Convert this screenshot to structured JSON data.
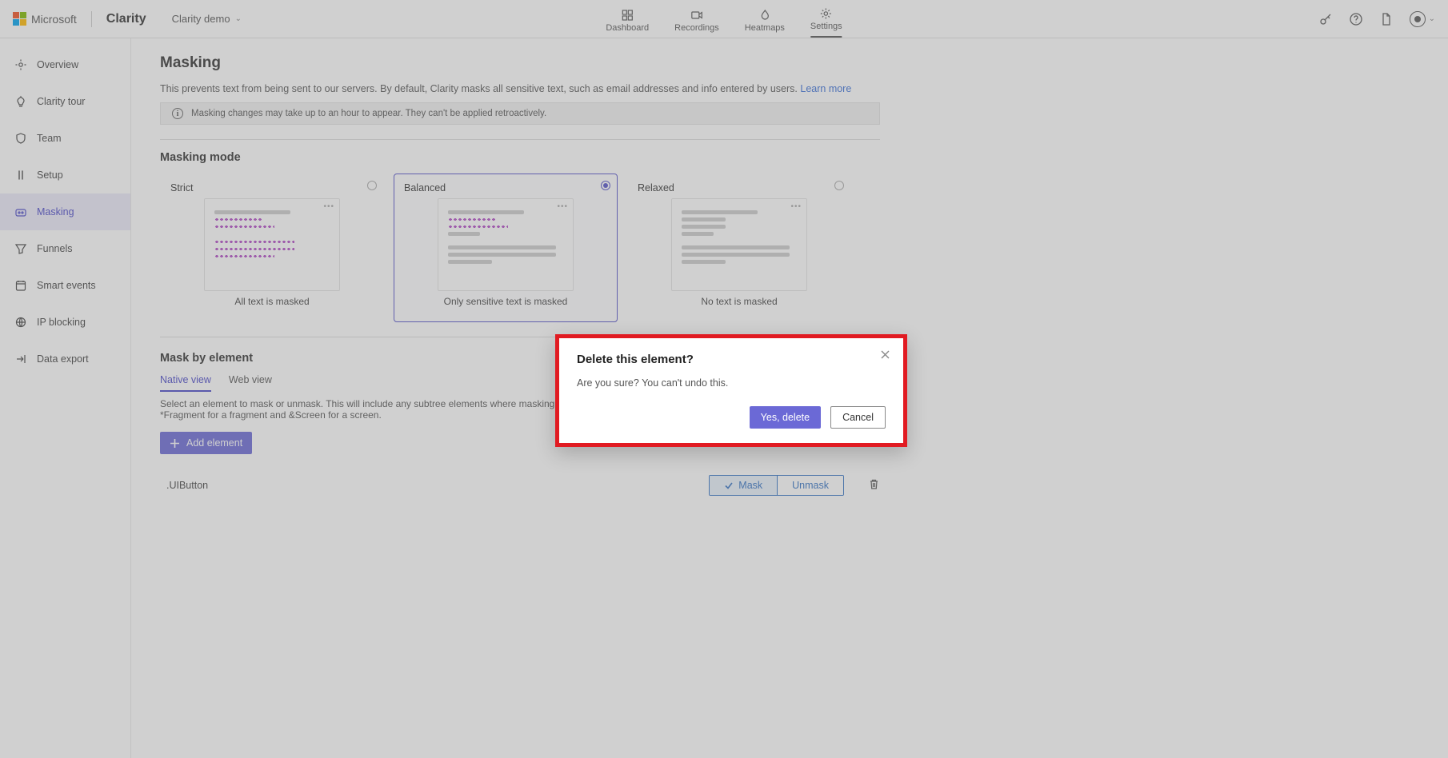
{
  "header": {
    "ms": "Microsoft",
    "brand": "Clarity",
    "project": "Clarity demo",
    "tabs": {
      "dashboard": "Dashboard",
      "recordings": "Recordings",
      "heatmaps": "Heatmaps",
      "settings": "Settings"
    }
  },
  "sidebar": {
    "overview": "Overview",
    "clarity_tour": "Clarity tour",
    "team": "Team",
    "setup": "Setup",
    "masking": "Masking",
    "funnels": "Funnels",
    "smart_events": "Smart events",
    "ip_blocking": "IP blocking",
    "data_export": "Data export"
  },
  "page": {
    "title": "Masking",
    "description": "This prevents text from being sent to our servers. By default, Clarity masks all sensitive text, such as email addresses and info entered by users. ",
    "learn_more": "Learn more",
    "info_note": "Masking changes may take up to an hour to appear. They can't be applied retroactively.",
    "mode_title": "Masking mode",
    "modes": {
      "strict": {
        "name": "Strict",
        "caption": "All text is masked"
      },
      "balanced": {
        "name": "Balanced",
        "caption": "Only sensitive text is masked"
      },
      "relaxed": {
        "name": "Relaxed",
        "caption": "No text is masked"
      }
    },
    "by_element": {
      "title": "Mask by element",
      "tabs": {
        "native": "Native view",
        "web": "Web view"
      },
      "hint": "Select an element to mask or unmask. This will include any subtree elements where masking or unmasking is applied. Use the following prefixes for Compose interop: *Fragment for a fragment and &Screen for a screen.",
      "add_button": "Add element",
      "element_name": ".UIButton",
      "mask": "Mask",
      "unmask": "Unmask"
    }
  },
  "dialog": {
    "title": "Delete this element?",
    "body": "Are you sure? You can't undo this.",
    "yes": "Yes, delete",
    "cancel": "Cancel"
  }
}
